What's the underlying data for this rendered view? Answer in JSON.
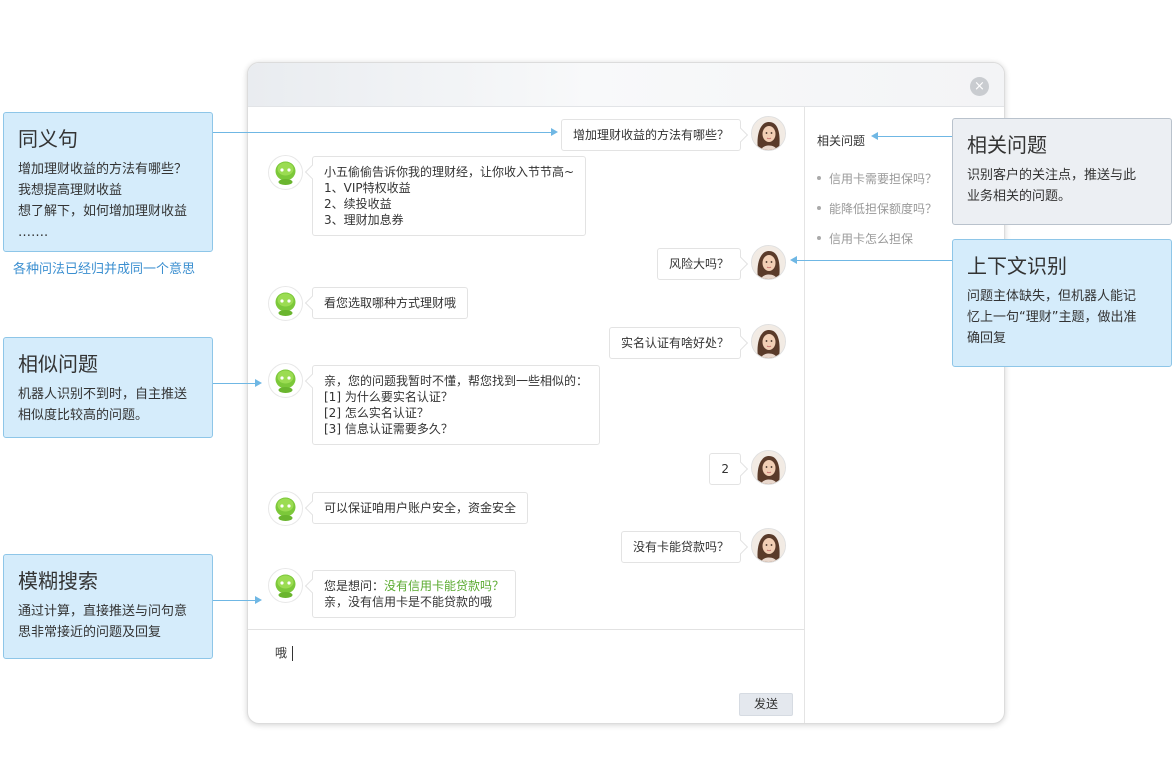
{
  "window": {
    "close_icon": "×",
    "send_label": "发送",
    "input_value": "哦"
  },
  "messages": {
    "m1": "增加理财收益的方法有哪些？",
    "m2": [
      "小五偷偷告诉你我的理财经，让你收入节节高~",
      "1、VIP特权收益",
      "2、续投收益",
      "3、理财加息券"
    ],
    "m3": "风险大吗？",
    "m4": "看您选取哪种方式理财哦",
    "m5": "实名认证有啥好处？",
    "m6": [
      "亲，您的问题我暂时不懂，帮您找到一些相似的：",
      "[1] 为什么要实名认证？",
      "[2] 怎么实名认证？",
      "[3] 信息认证需要多久？"
    ],
    "m7": "2",
    "m8": "可以保证咱用户账户安全，资金安全",
    "m9": "没有卡能贷款吗？",
    "m10_prefix": "您是想问：",
    "m10_link": "没有信用卡能贷款吗？",
    "m10_line2": "亲，没有信用卡是不能贷款的哦"
  },
  "sidebar": {
    "title": "相关问题",
    "items": [
      "信用卡需要担保吗？",
      "能降低担保额度吗？",
      "信用卡怎么担保"
    ]
  },
  "callouts": {
    "synonym": {
      "title": "同义句",
      "lines": [
        "增加理财收益的方法有哪些？",
        "我想提高理财收益",
        "想了解下，如何增加理财收益",
        "……."
      ],
      "note": "各种问法已经归并成同一个意思"
    },
    "similar": {
      "title": "相似问题",
      "lines": [
        "机器人识别不到时，自主推送",
        "相似度比较高的问题。"
      ]
    },
    "fuzzy": {
      "title": "模糊搜索",
      "lines": [
        "通过计算，直接推送与问句意",
        "思非常接近的问题及回复"
      ]
    },
    "related": {
      "title": "相关问题",
      "lines": [
        "识别客户的关注点，推送与此",
        "业务相关的问题。"
      ]
    },
    "context": {
      "title": "上下文识别",
      "lines": [
        "问题主体缺失，但机器人能记",
        "忆上一句“理财”主题，做出准",
        "确回复"
      ]
    }
  },
  "colors": {
    "callout_bg": "#d5ecfb",
    "callout_border": "#8ec6e8",
    "note_blue": "#3b8fd0",
    "link_green": "#5aaa2f"
  },
  "icons": {
    "bot_avatar": "green-robot-icon",
    "user_avatar": "woman-avatar"
  }
}
